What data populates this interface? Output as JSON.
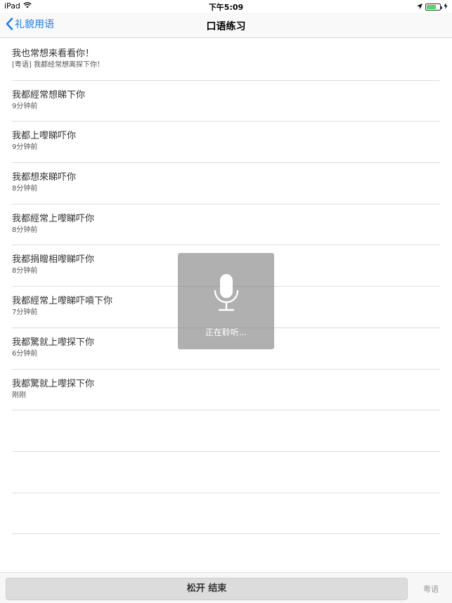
{
  "status": {
    "device": "iPad",
    "time": "下午5:09"
  },
  "nav": {
    "back_label": "礼貌用语",
    "title": "口语练习"
  },
  "items": [
    {
      "text": "我也常想来看看你！",
      "sub": "[粤语] 我都经常想离探下你！"
    },
    {
      "text": "我都經常想睇下你",
      "sub": "9分钟前"
    },
    {
      "text": "我都上嚟睇吓你",
      "sub": "9分钟前"
    },
    {
      "text": "我都想來睇吓你",
      "sub": "8分钟前"
    },
    {
      "text": "我都經常上嚟睇吓你",
      "sub": "8分钟前"
    },
    {
      "text": "我都捐贈相嚟睇吓你",
      "sub": "8分钟前"
    },
    {
      "text": "我都經常上嚟睇吓嗊下你",
      "sub": "7分钟前"
    },
    {
      "text": "我都驚就上嚟探下你",
      "sub": "6分钟前"
    },
    {
      "text": "我都驚就上嚟探下你",
      "sub": "刚刚"
    }
  ],
  "listening": {
    "label": "正在聆听...",
    "icon": "microphone-icon"
  },
  "bottom": {
    "release_label": "松开 结束",
    "language_label": "粤语"
  },
  "colors": {
    "accent": "#1a7ef0",
    "battery": "#4cd964"
  }
}
